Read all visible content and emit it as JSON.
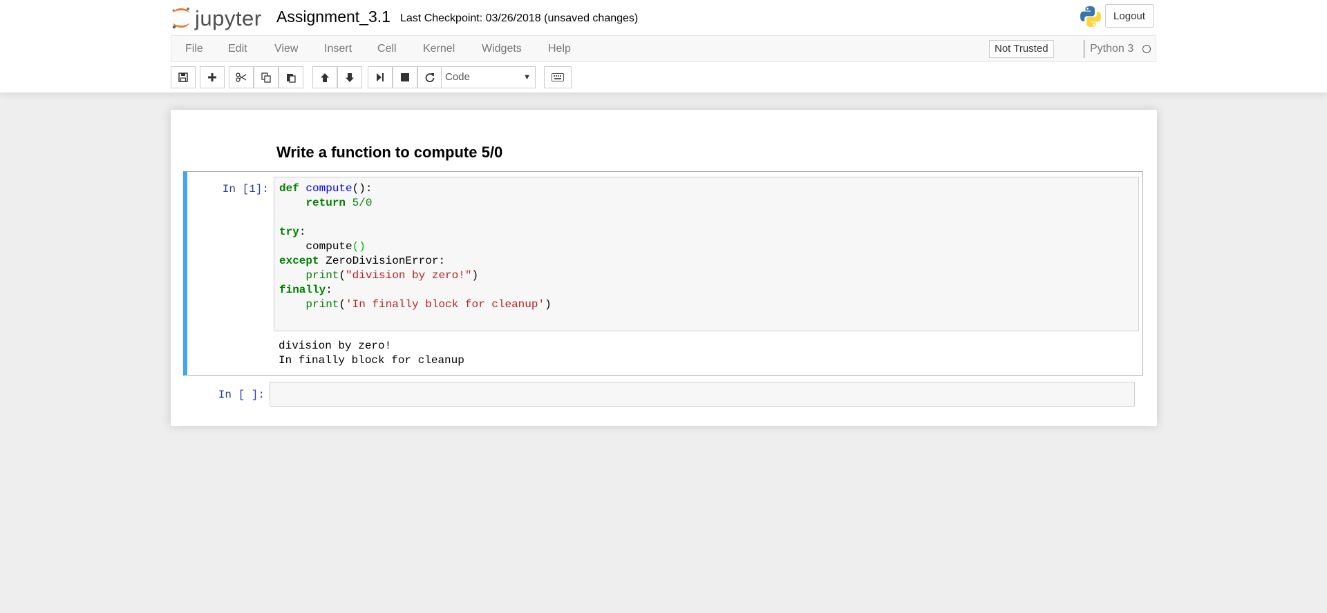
{
  "header": {
    "logo_text": "jupyter",
    "notebook_name": "Assignment_3.1",
    "checkpoint": "Last Checkpoint: 03/26/2018 (unsaved changes)",
    "logout_label": "Logout"
  },
  "menubar": {
    "items": [
      "File",
      "Edit",
      "View",
      "Insert",
      "Cell",
      "Kernel",
      "Widgets",
      "Help"
    ],
    "trust_label": "Not Trusted",
    "kernel_name": "Python 3"
  },
  "toolbar": {
    "buttons": [
      "save-icon",
      "plus-icon",
      "cut-icon",
      "copy-icon",
      "paste-icon",
      "arrow-up-icon",
      "arrow-down-icon",
      "run-icon",
      "stop-icon",
      "restart-icon",
      "keyboard-icon"
    ],
    "cell_type": "Code"
  },
  "notebook": {
    "markdown_heading": "Write a function to compute 5/0",
    "cells": [
      {
        "prompt": "In [1]:",
        "code_lines": [
          "def compute():",
          "    return 5/0",
          "",
          "try:",
          "    compute()",
          "except ZeroDivisionError:",
          "    print(\"division by zero!\")",
          "finally:",
          "    print('In finally block for cleanup')"
        ],
        "output": "division by zero!\nIn finally block for cleanup"
      },
      {
        "prompt": "In [ ]:",
        "code_lines": []
      }
    ]
  },
  "colors": {
    "selected_cell_bar": "#42a5f5",
    "keyword": "#008000",
    "string": "#ba2121",
    "prompt": "#303f9f"
  }
}
